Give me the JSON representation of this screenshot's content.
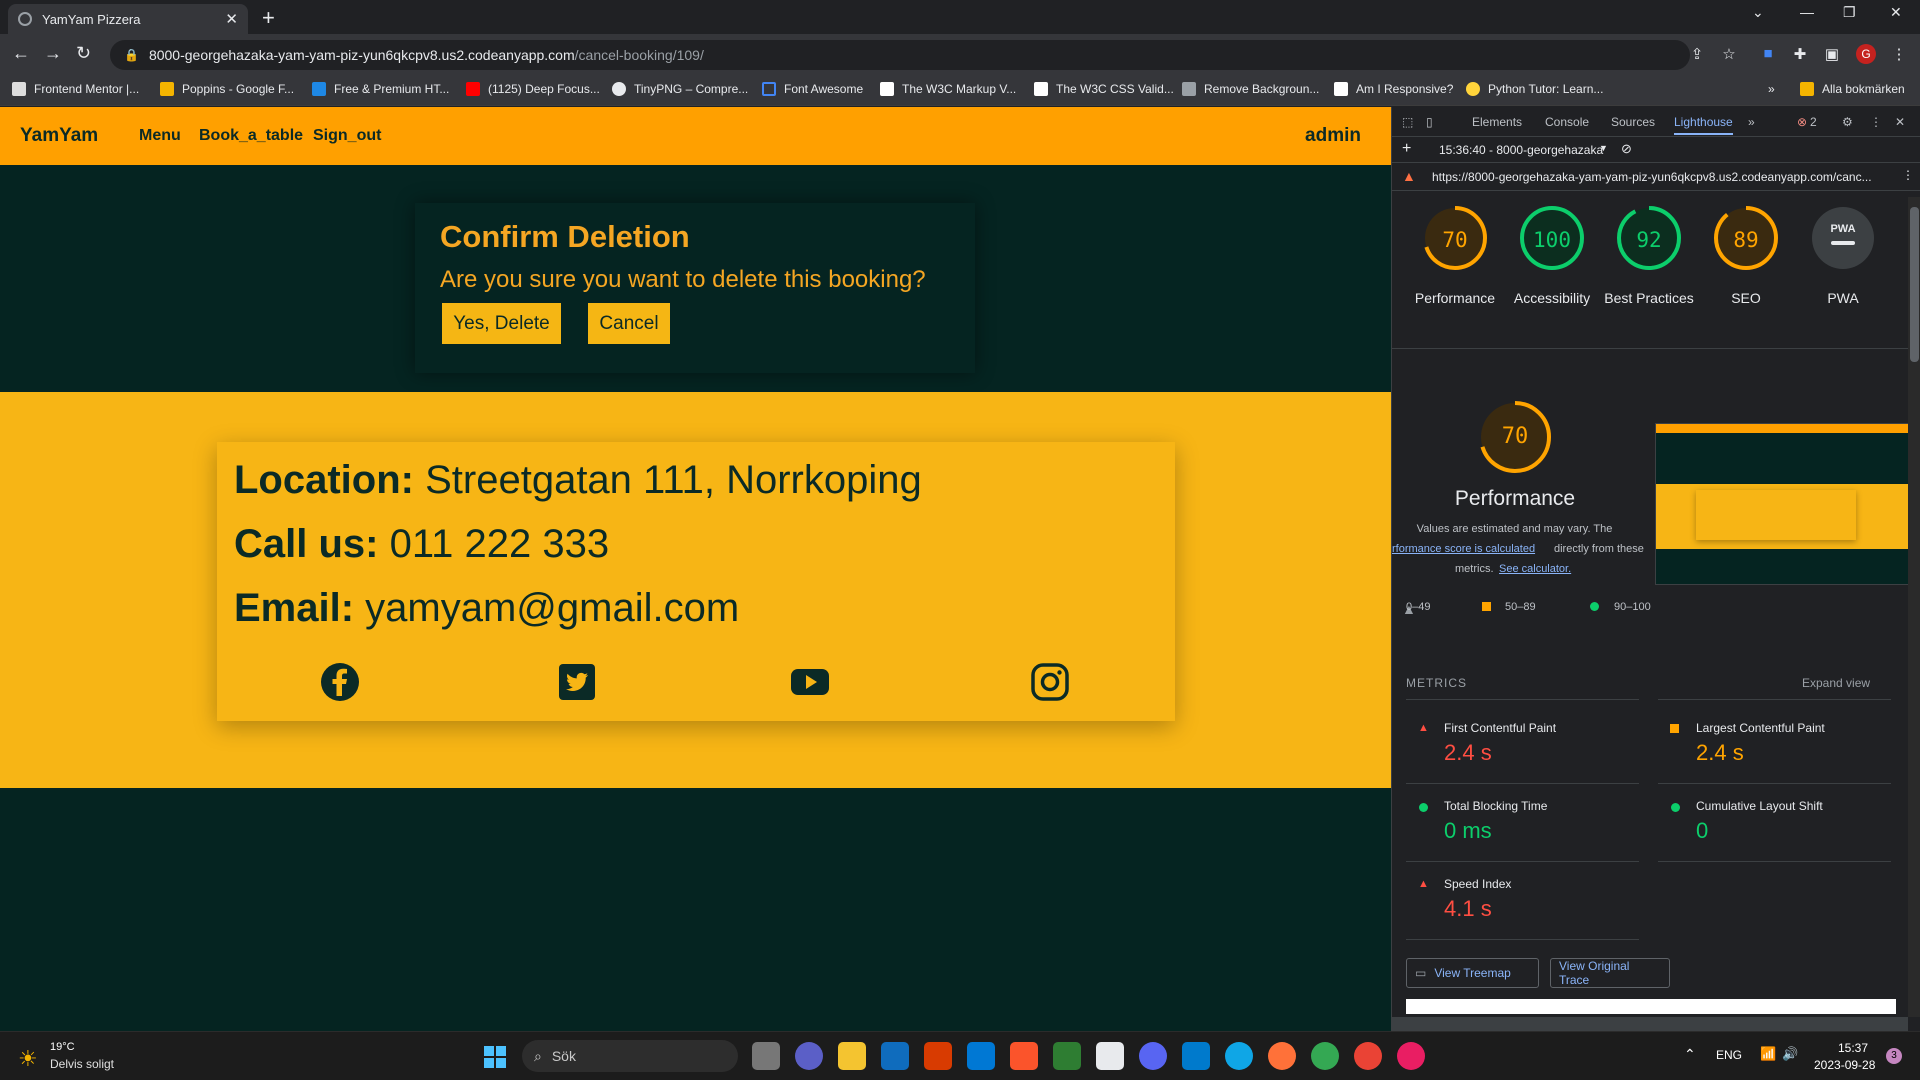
{
  "browser": {
    "tab_title": "YamYam Pizzera",
    "url_host": "8000-georgehazaka-yam-yam-piz-yun6qkcpv8.us2.codeanyapp.com",
    "url_path": "/cancel-booking/109/",
    "avatar_letter": "G",
    "bookmarks": [
      "Frontend Mentor |...",
      "Poppins - Google F...",
      "Free & Premium HT...",
      "(1125) Deep Focus...",
      "TinyPNG – Compre...",
      "Font Awesome",
      "The W3C Markup V...",
      "The W3C CSS Valid...",
      "Remove Backgroun...",
      "Am I Responsive?",
      "Python Tutor: Learn..."
    ],
    "all_bookmarks": "Alla bokmärken"
  },
  "site": {
    "brand": "YamYam",
    "nav": [
      "Menu",
      "Book_a_table",
      "Sign_out"
    ],
    "user": "admin",
    "confirm": {
      "title": "Confirm Deletion",
      "question": "Are you sure you want to delete this booking?",
      "yes_label": "Yes, Delete",
      "cancel_label": "Cancel"
    },
    "contact": {
      "location_label": "Location:",
      "location_value": "Streetgatan 111, Norrkoping",
      "call_label": "Call us:",
      "call_value": "011 222 333",
      "email_label": "Email:",
      "email_value": "yamyam@gmail.com"
    },
    "colors": {
      "nav": "#ffa000",
      "page_bg": "#052421",
      "accent": "#f5a623",
      "band": "#f7b515"
    }
  },
  "devtools": {
    "tabs": [
      "Elements",
      "Console",
      "Sources",
      "Lighthouse"
    ],
    "error_count": "2",
    "report_select": "15:36:40 - 8000-georgehazaka",
    "report_url": "https://8000-georgehazaka-yam-yam-piz-yun6qkcpv8.us2.codeanyapp.com/canc...",
    "scores": [
      {
        "label": "Performance",
        "value": "70",
        "color": "#ffa400"
      },
      {
        "label": "Accessibility",
        "value": "100",
        "color": "#0cce6b"
      },
      {
        "label": "Best Practices",
        "value": "92",
        "color": "#0cce6b"
      },
      {
        "label": "SEO",
        "value": "89",
        "color": "#ffa400"
      },
      {
        "label": "PWA",
        "value": "PWA",
        "color": "#9aa0a6"
      }
    ],
    "perf_big": "70",
    "perf_title": "Performance",
    "perf_note_1": "Values are estimated and may vary. The",
    "perf_note_link": "rformance score is calculated",
    "perf_note_2": "directly from these",
    "perf_note_3": "metrics.",
    "see_calc": "See calculator.",
    "legend": [
      "0–49",
      "50–89",
      "90–100"
    ],
    "metrics_heading": "METRICS",
    "expand_view": "Expand view",
    "metrics": [
      {
        "name": "First Contentful Paint",
        "value": "2.4 s",
        "color": "#ff4e42"
      },
      {
        "name": "Largest Contentful Paint",
        "value": "2.4 s",
        "color": "#ffa400"
      },
      {
        "name": "Total Blocking Time",
        "value": "0 ms",
        "color": "#0cce6b"
      },
      {
        "name": "Cumulative Layout Shift",
        "value": "0",
        "color": "#0cce6b"
      },
      {
        "name": "Speed Index",
        "value": "4.1 s",
        "color": "#ff4e42"
      }
    ],
    "view_treemap": "View Treemap",
    "view_trace": "View Original Trace"
  },
  "taskbar": {
    "temp": "19°C",
    "weather": "Delvis soligt",
    "search": "Sök",
    "lang": "ENG",
    "time": "15:37",
    "date": "2023-09-28",
    "notif": "3"
  }
}
